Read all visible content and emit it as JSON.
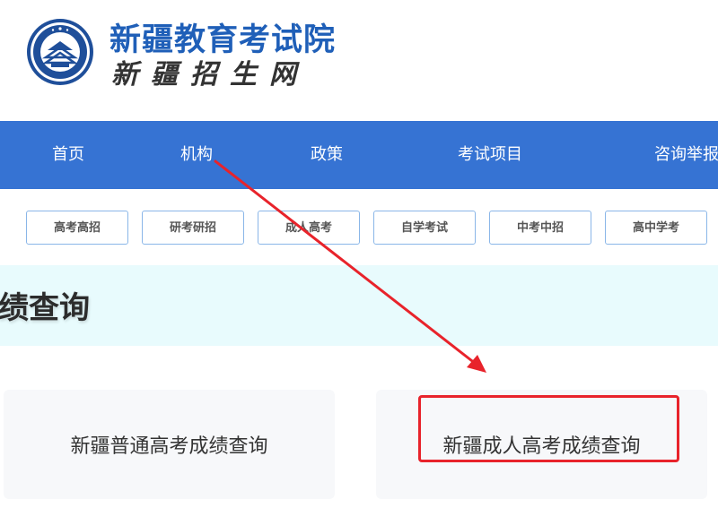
{
  "header": {
    "title": "新疆教育考试院",
    "subtitle": "新疆招生网"
  },
  "nav": {
    "items": [
      {
        "label": "首页"
      },
      {
        "label": "机构"
      },
      {
        "label": "政策"
      },
      {
        "label": "考试项目"
      },
      {
        "label": "咨询举报"
      }
    ]
  },
  "subnav": {
    "items": [
      {
        "label": "高考高招"
      },
      {
        "label": "研考研招"
      },
      {
        "label": "成人高考"
      },
      {
        "label": "自学考试"
      },
      {
        "label": "中考中招"
      },
      {
        "label": "高中学考"
      }
    ]
  },
  "banner": {
    "title": "成绩查询"
  },
  "cards": [
    {
      "label": "新疆普通高考成绩查询"
    },
    {
      "label": "新疆成人高考成绩查询"
    }
  ],
  "colors": {
    "brand_blue": "#1f5fb8",
    "nav_bg": "#3673d3",
    "banner_bg": "#e8fbfd",
    "annotation_red": "#e8232b"
  },
  "icons": {
    "logo": "exam-institute-emblem-icon",
    "annotation": "red-arrow-icon"
  }
}
